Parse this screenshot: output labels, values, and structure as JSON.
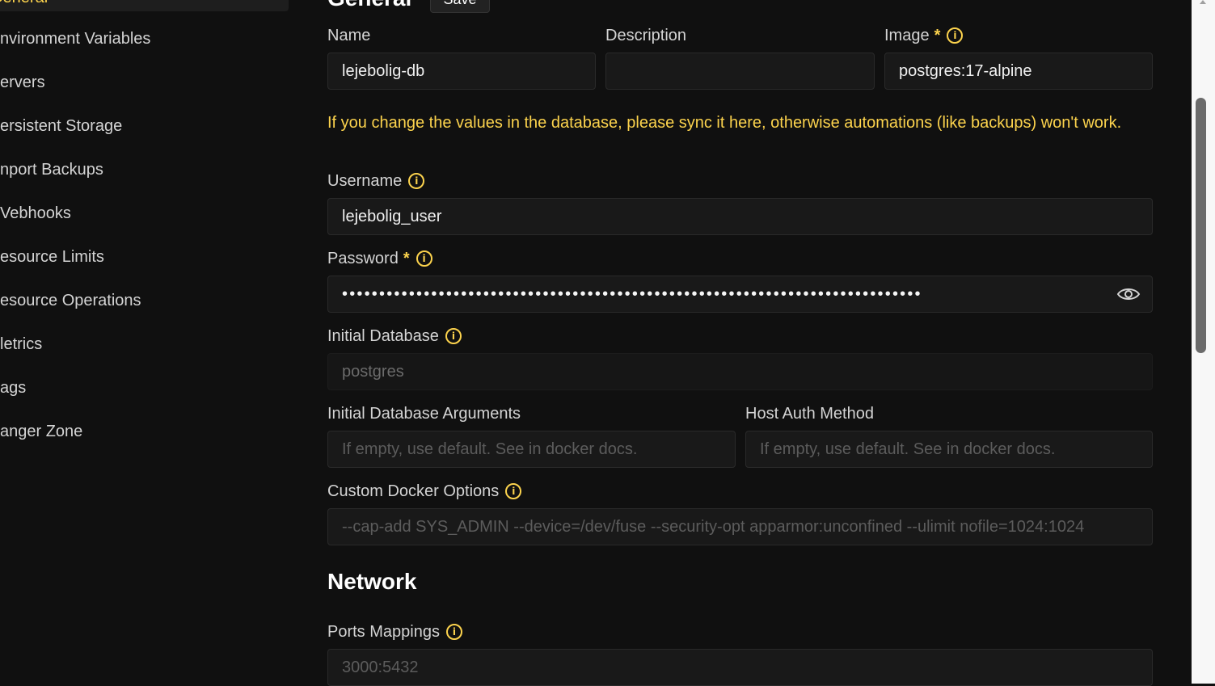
{
  "sidebar": {
    "active_label": "General",
    "items": [
      {
        "label": "nvironment Variables"
      },
      {
        "label": "ervers"
      },
      {
        "label": "ersistent Storage"
      },
      {
        "label": "nport Backups"
      },
      {
        "label": "Vebhooks"
      },
      {
        "label": "esource Limits"
      },
      {
        "label": "esource Operations"
      },
      {
        "label": "letrics"
      },
      {
        "label": "ags"
      },
      {
        "label": "anger Zone"
      }
    ]
  },
  "header": {
    "title": "General",
    "save_label": "Save"
  },
  "fields": {
    "name": {
      "label": "Name",
      "value": "lejebolig-db"
    },
    "description": {
      "label": "Description",
      "value": ""
    },
    "image": {
      "label": "Image",
      "required": "*",
      "value": "postgres:17-alpine"
    },
    "warning": "If you change the values in the database, please sync it here, otherwise automations (like backups) won't work.",
    "username": {
      "label": "Username",
      "value": "lejebolig_user"
    },
    "password": {
      "label": "Password",
      "required": "*",
      "masked_value": "••••••••••••••••••••••••••••••••••••••••••••••••••••••••••••••••••••••••••••••"
    },
    "initial_database": {
      "label": "Initial Database",
      "value": "postgres"
    },
    "initial_database_arguments": {
      "label": "Initial Database Arguments",
      "placeholder": "If empty, use default. See in docker docs."
    },
    "host_auth_method": {
      "label": "Host Auth Method",
      "placeholder": "If empty, use default. See in docker docs."
    },
    "custom_docker_options": {
      "label": "Custom Docker Options",
      "placeholder": "--cap-add SYS_ADMIN --device=/dev/fuse --security-opt apparmor:unconfined --ulimit nofile=1024:1024"
    }
  },
  "network": {
    "title": "Network",
    "ports_mappings": {
      "label": "Ports Mappings",
      "placeholder": "3000:5432"
    }
  },
  "icons": {
    "info": "info-circle-icon",
    "eye": "eye-icon"
  },
  "colors": {
    "accent": "#fcd34d",
    "background": "#101010",
    "field": "#191919"
  }
}
